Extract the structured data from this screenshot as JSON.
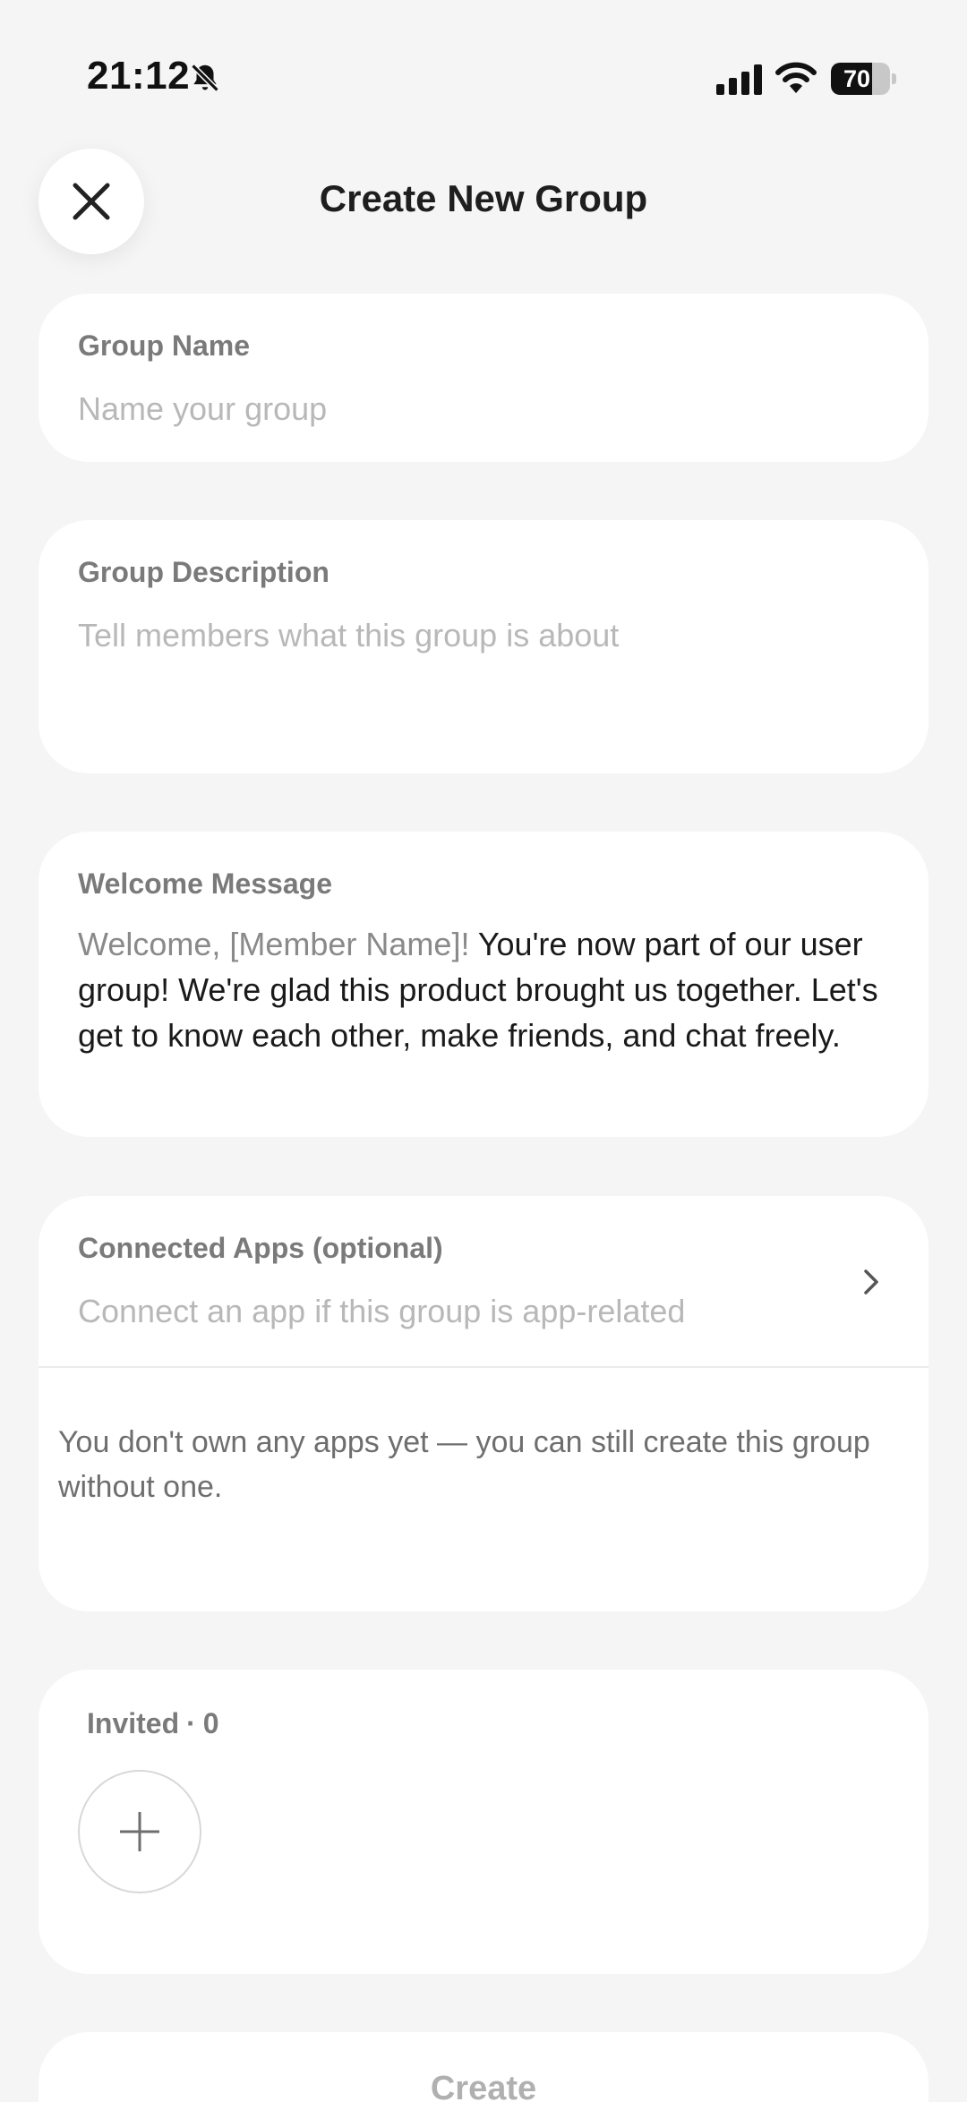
{
  "status_bar": {
    "time": "21:12",
    "battery_percent": 70,
    "battery_label": "70",
    "icons": [
      "bell-off-icon",
      "signal-icon",
      "wifi-icon",
      "battery-icon"
    ]
  },
  "header": {
    "title": "Create New Group",
    "close_icon": "close-icon"
  },
  "group_name": {
    "label": "Group Name",
    "placeholder": "Name your group",
    "value": ""
  },
  "group_description": {
    "label": "Group Description",
    "placeholder": "Tell members what this group is about",
    "value": ""
  },
  "welcome_message": {
    "label": "Welcome Message",
    "prefix": "Welcome, [Member Name]!",
    "body": "You're now part of our user group! We're glad this product brought us together. Let's get to know each other, make friends, and chat freely."
  },
  "connected_apps": {
    "label": "Connected Apps (optional)",
    "placeholder": "Connect an app if this group is app-related",
    "note": "You don't own any apps yet — you can still create this group without one."
  },
  "invited": {
    "label": "Invited",
    "separator": "·",
    "count": "0"
  },
  "create_button": {
    "label": "Create",
    "enabled": false
  },
  "colors": {
    "background": "#f5f5f5",
    "card": "#ffffff",
    "label": "#7a7a7a",
    "placeholder": "#b8b8b8",
    "text": "#1a1a1a",
    "disabled": "#b0b0b0"
  }
}
